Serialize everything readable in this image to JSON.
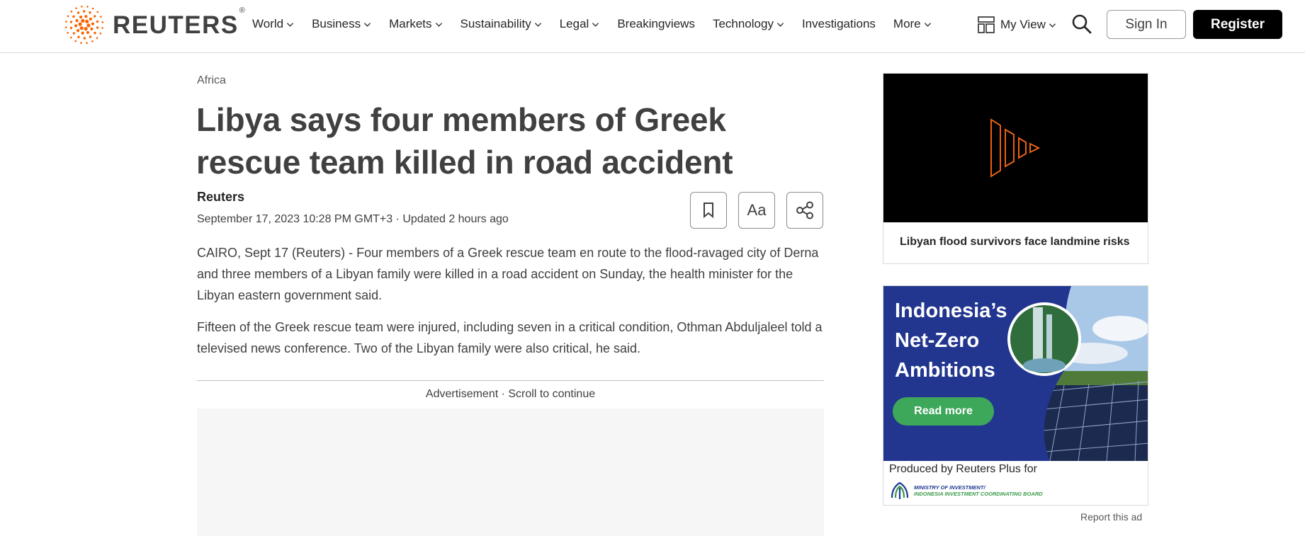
{
  "header": {
    "brand": "REUTERS",
    "brand_mark": "®",
    "nav": [
      {
        "label": "World",
        "dropdown": true
      },
      {
        "label": "Business",
        "dropdown": true
      },
      {
        "label": "Markets",
        "dropdown": true
      },
      {
        "label": "Sustainability",
        "dropdown": true
      },
      {
        "label": "Legal",
        "dropdown": true
      },
      {
        "label": "Breakingviews",
        "dropdown": false
      },
      {
        "label": "Technology",
        "dropdown": true
      },
      {
        "label": "Investigations",
        "dropdown": false
      },
      {
        "label": "More",
        "dropdown": true
      }
    ],
    "my_view": "My View",
    "sign_in": "Sign In",
    "register": "Register"
  },
  "article": {
    "section": "Africa",
    "headline": "Libya says four members of Greek rescue team killed in road accident",
    "byline": "Reuters",
    "dateline": "September 17, 2023 10:28 PM GMT+3 · Updated 2 hours ago",
    "text_size_label": "Aa",
    "paragraphs": [
      "CAIRO, Sept 17 (Reuters) - Four members of a Greek rescue team en route to the flood-ravaged city of Derna and three members of a Libyan family were killed in a road accident on Sunday, the health minister for the Libyan eastern government said.",
      "Fifteen of the Greek rescue team were injured, including seven in a critical condition, Othman Abduljaleel told a televised news conference. Two of the Libyan family were also critical, he said."
    ],
    "ad_label": "Advertisement · Scroll to continue"
  },
  "sidebar": {
    "video_caption": "Libyan flood survivors face landmine risks",
    "ad": {
      "headline_lines": [
        "Indonesia’s",
        "Net-Zero",
        "Ambitions"
      ],
      "cta": "Read more",
      "produced_by": "Produced by Reuters Plus for",
      "ministry_line1": "MINISTRY OF INVESTMENT/",
      "ministry_line2": "INDONESIA INVESTMENT COORDINATING BOARD"
    },
    "report_ad": "Report this ad"
  },
  "colors": {
    "brand_orange": "#fa6400",
    "ad_blue": "#22368f",
    "ad_green": "#3ea85a"
  }
}
